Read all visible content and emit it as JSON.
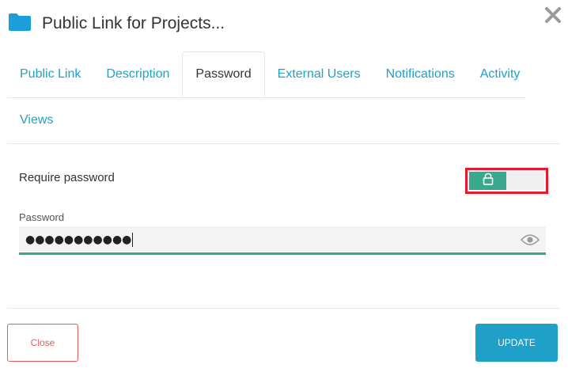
{
  "header": {
    "title": "Public Link for Projects...",
    "folder_icon": "folder-icon",
    "close_icon": "close-icon"
  },
  "tabs": [
    {
      "label": "Public Link",
      "active": false
    },
    {
      "label": "Description",
      "active": false
    },
    {
      "label": "Password",
      "active": true
    },
    {
      "label": "External Users",
      "active": false
    },
    {
      "label": "Notifications",
      "active": false
    },
    {
      "label": "Activity",
      "active": false
    },
    {
      "label": "Views",
      "active": false
    }
  ],
  "require_password": {
    "label": "Require password",
    "enabled": true,
    "toggle_icon": "lock-icon"
  },
  "password": {
    "label": "Password",
    "value": "●●●●●●●●●●●",
    "visibility_icon": "eye-icon"
  },
  "footer": {
    "close_label": "Close",
    "update_label": "UPDATE"
  },
  "colors": {
    "accent": "#1fa0c8",
    "toggle_on": "#3aa88d",
    "danger": "#e55a5a",
    "highlight_box": "#e8192c"
  }
}
